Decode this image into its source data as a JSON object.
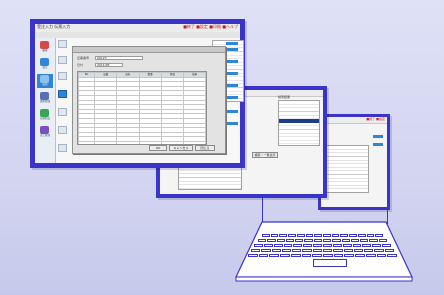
{
  "front_window": {
    "title_left": "受注入力 伝票入力",
    "title_right": "■終了  ■設定  ■印刷  ■ヘルプ",
    "menu_items": [
      "ファイル",
      "編集",
      "表示",
      "ツール"
    ],
    "sidebar_items": [
      "顧客",
      "受注",
      "出荷",
      "請求管理",
      "在庫照会",
      "売上管理"
    ],
    "dialog": {
      "label_1": "伝票番号",
      "value_1": "00123",
      "label_2": "日付",
      "value_2": "2011/05",
      "columns": [
        "No",
        "品番",
        "品名",
        "数量",
        "単価",
        "金額"
      ],
      "row_count": 17,
      "button_ok": "OK",
      "button_cancel": "キャンセル",
      "button_close": "閉じる"
    }
  },
  "middle_window": {
    "list_label": "検索結果",
    "button_label": "検索・一覧表示"
  },
  "back_window": {
    "title_right": "■終了 ■設定"
  },
  "colors": {
    "frame_border": "#3b34c9",
    "accent_blue": "#2f86d6",
    "title_red": "#cc1b1b"
  }
}
